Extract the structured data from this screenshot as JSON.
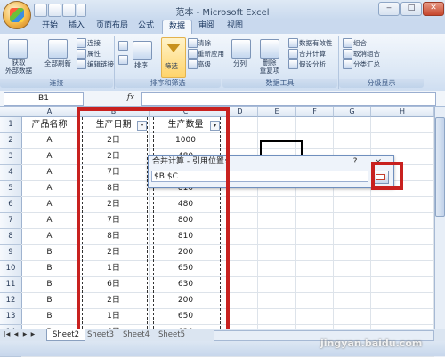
{
  "window": {
    "title": "范本 - Microsoft Excel"
  },
  "ribbon_tabs": [
    "开始",
    "插入",
    "页面布局",
    "公式",
    "数据",
    "审阅",
    "视图"
  ],
  "active_tab": "数据",
  "ribbon": {
    "get_external": "获取\n外部数据",
    "refresh_all": "全部刷新",
    "connections": "连接",
    "properties": "属性",
    "edit_links": "编辑链接",
    "connections_group": "连接",
    "sort": "排序...",
    "filter": "筛选",
    "clear": "清除",
    "reapply": "重新应用",
    "advanced": "高级",
    "sort_filter_group": "排序和筛选",
    "text_to_columns": "分列",
    "remove_duplicates": "删除\n重复项",
    "data_validation": "数据有效性",
    "consolidate": "合并计算",
    "what_if": "假设分析",
    "data_tools_group": "数据工具",
    "group": "组合",
    "ungroup": "取消组合",
    "subtotal": "分类汇总",
    "outline_group": "分级显示"
  },
  "name_box": "B1",
  "fx_label": "fx",
  "columns": [
    "A",
    "B",
    "C",
    "D",
    "E",
    "F",
    "G",
    "H"
  ],
  "rows": [
    {
      "num": "1",
      "a": "产品名称",
      "b": "生产日期",
      "c": "生产数量"
    },
    {
      "num": "2",
      "a": "A",
      "b": "2日",
      "c": "1000"
    },
    {
      "num": "3",
      "a": "A",
      "b": "2日",
      "c": "480"
    },
    {
      "num": "4",
      "a": "A",
      "b": "7日",
      "c": "800"
    },
    {
      "num": "5",
      "a": "A",
      "b": "8日",
      "c": "810"
    },
    {
      "num": "6",
      "a": "A",
      "b": "2日",
      "c": "480"
    },
    {
      "num": "7",
      "a": "A",
      "b": "7日",
      "c": "800"
    },
    {
      "num": "8",
      "a": "A",
      "b": "8日",
      "c": "810"
    },
    {
      "num": "9",
      "a": "B",
      "b": "2日",
      "c": "200"
    },
    {
      "num": "10",
      "a": "B",
      "b": "1日",
      "c": "650"
    },
    {
      "num": "11",
      "a": "B",
      "b": "6日",
      "c": "630"
    },
    {
      "num": "12",
      "a": "B",
      "b": "2日",
      "c": "200"
    },
    {
      "num": "13",
      "a": "B",
      "b": "1日",
      "c": "650"
    },
    {
      "num": "14",
      "a": "B",
      "b": "6日",
      "c": "630"
    },
    {
      "num": "15",
      "a": "B",
      "b": "2日",
      "c": "200"
    }
  ],
  "dialog": {
    "title": "合并计算 - 引用位置:",
    "help": "?",
    "close": "×",
    "reference_value": "$B:$C"
  },
  "sheet_tabs": [
    "Sheet2",
    "Sheet3",
    "Sheet4",
    "Sheet5"
  ],
  "active_sheet": "Sheet2",
  "watermark": "jingyan.baidu.com",
  "colors": {
    "highlight_red": "#c8211f",
    "ribbon_blue": "#dbe7f5"
  }
}
